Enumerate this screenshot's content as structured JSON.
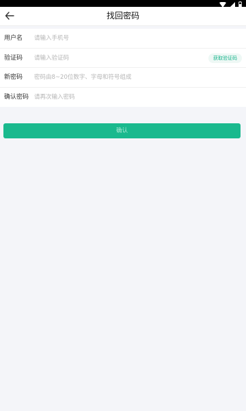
{
  "status_bar": {
    "icons": [
      "wifi-icon",
      "signal-icon",
      "battery-icon"
    ]
  },
  "header": {
    "back_icon": "arrow-left-icon",
    "title": "找回密码"
  },
  "form": {
    "username": {
      "label": "用户名",
      "placeholder": "请输入手机号",
      "value": ""
    },
    "code": {
      "label": "验证码",
      "placeholder": "请输入验证码",
      "value": "",
      "button_label": "获取验证码"
    },
    "new_password": {
      "label": "新密码",
      "placeholder": "密码由8~20位数字、字母和符号组成",
      "value": ""
    },
    "confirm_password": {
      "label": "确认密码",
      "placeholder": "请再次输入密码",
      "value": ""
    }
  },
  "confirm_button": {
    "label": "确认"
  },
  "colors": {
    "accent": "#1ab98e",
    "background": "#f4f5f9",
    "status_bar": "#000000"
  }
}
